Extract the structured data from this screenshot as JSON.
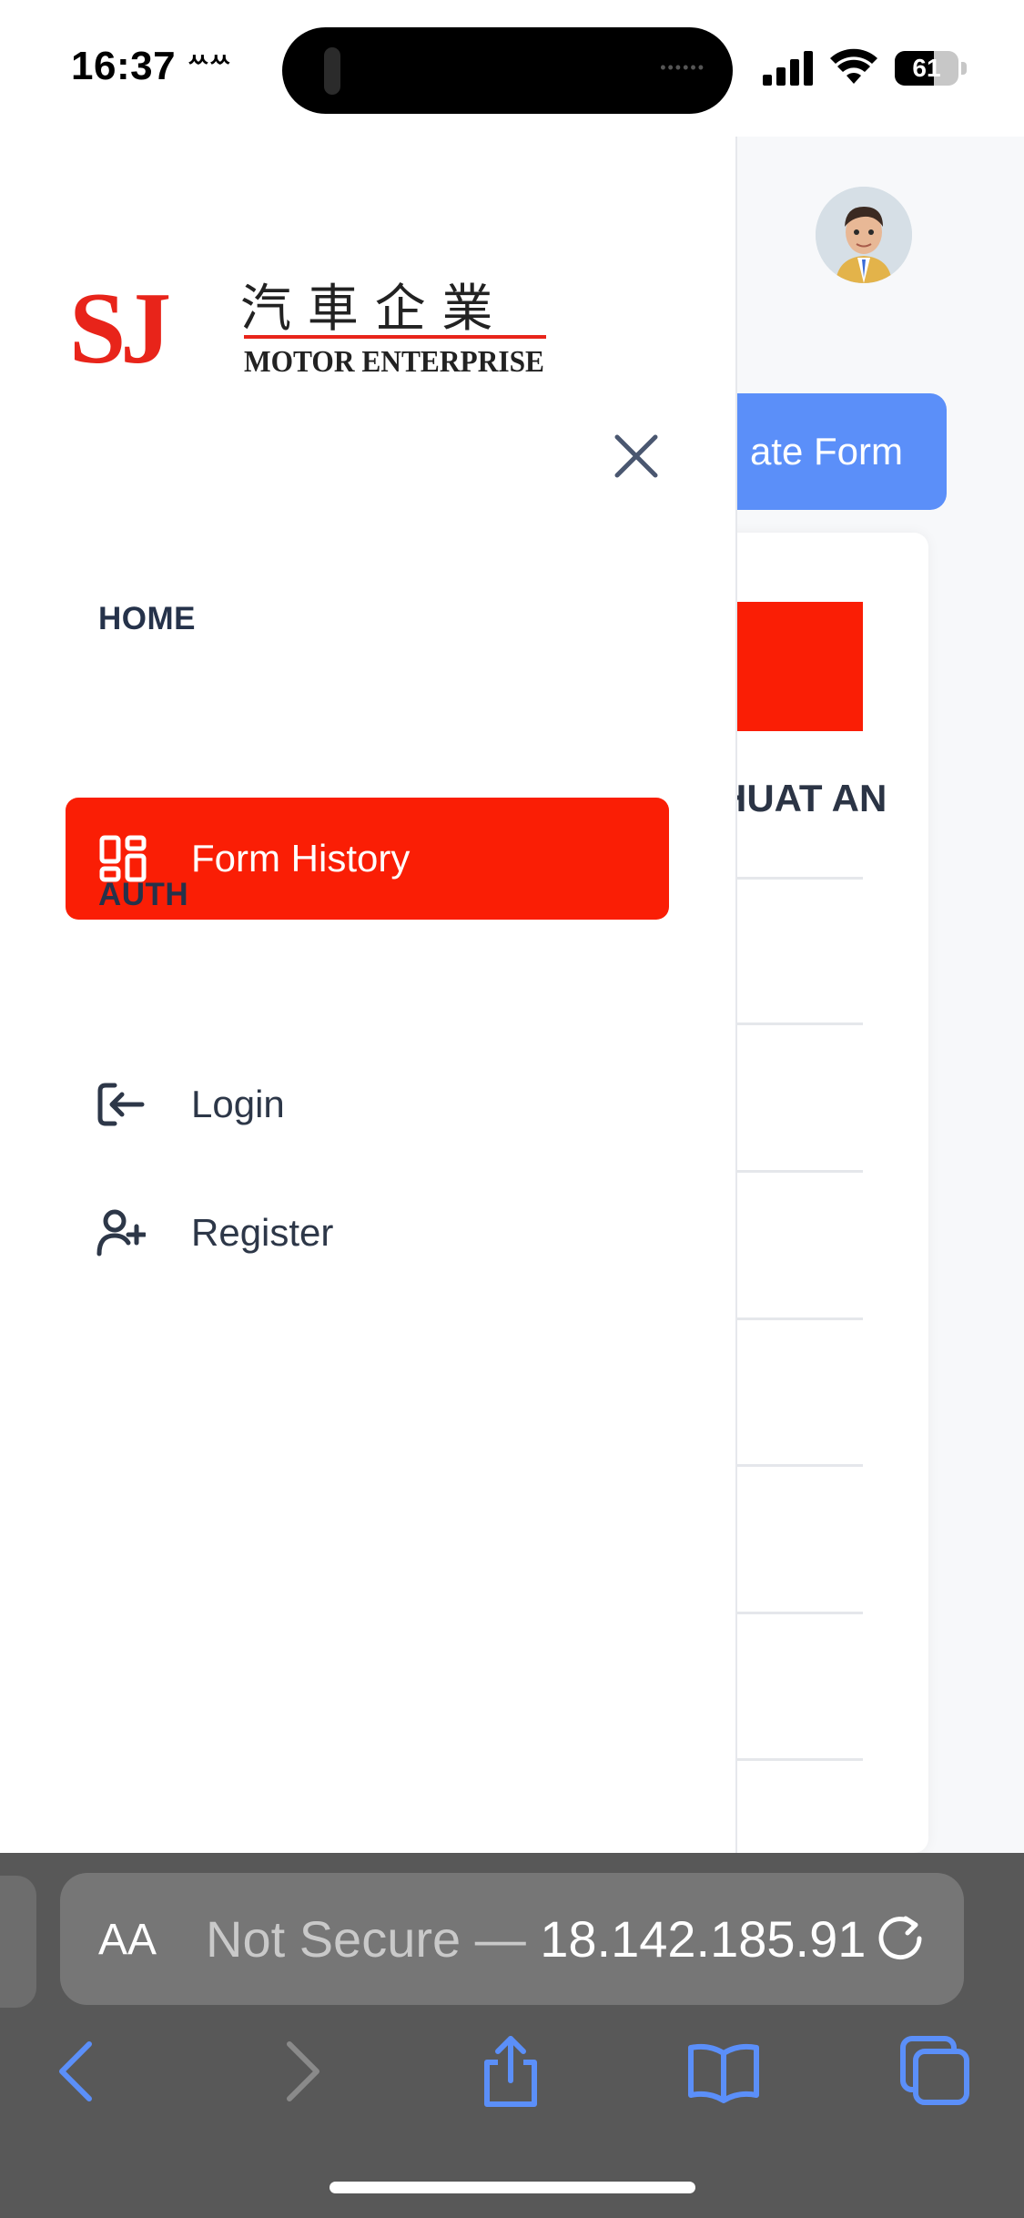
{
  "status_bar": {
    "time": "16:37",
    "extra_indicator": "ᄊᄊ",
    "battery_level": "61",
    "battery_fraction": 0.61
  },
  "background_page": {
    "create_button_label": "ate Form",
    "card_title": "HUAT AN"
  },
  "drawer": {
    "logo": {
      "brand_mark": "SJ",
      "chinese_name": "汽 車 企 業",
      "english_name": "MOTOR ENTERPRISE"
    },
    "sections": [
      {
        "title": "HOME",
        "items": [
          {
            "label": "Form History",
            "icon": "dashboard-icon",
            "active": true
          }
        ]
      },
      {
        "title": "AUTH",
        "items": [
          {
            "label": "Login",
            "icon": "login-icon",
            "active": false
          },
          {
            "label": "Register",
            "icon": "user-plus-icon",
            "active": false
          }
        ]
      }
    ]
  },
  "safari": {
    "aa_label": "AA",
    "url_prefix": "Not Secure — ",
    "url_host": "18.142.185.91"
  },
  "colors": {
    "accent_red": "#fa1e05",
    "primary_blue": "#5b8ff9",
    "text_dark": "#25324a"
  }
}
